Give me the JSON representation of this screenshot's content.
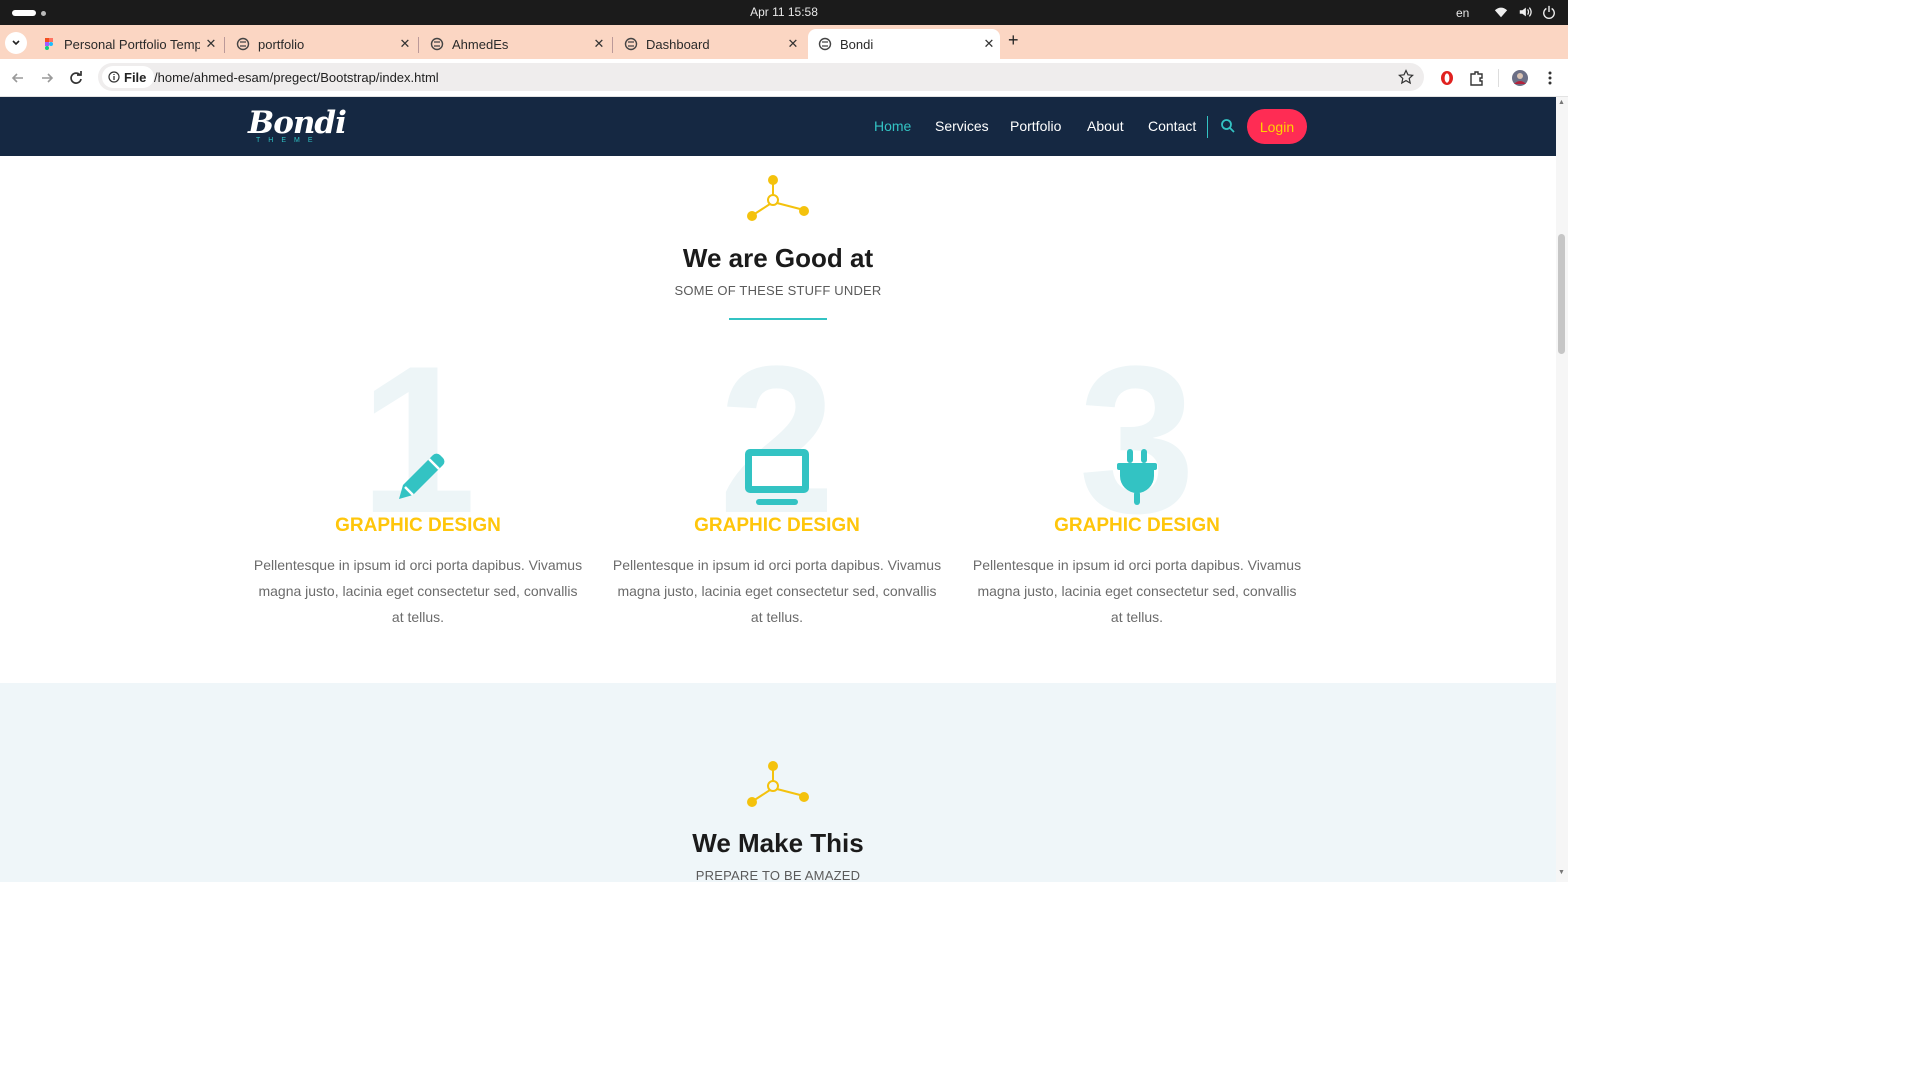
{
  "os": {
    "datetime": "Apr 11  15:58",
    "lang": "en"
  },
  "tabs": [
    {
      "title": "Personal Portfolio Templ",
      "active": false
    },
    {
      "title": "portfolio",
      "active": false
    },
    {
      "title": "AhmedEs",
      "active": false
    },
    {
      "title": "Dashboard",
      "active": false
    },
    {
      "title": "Bondi",
      "active": true
    }
  ],
  "toolbar": {
    "chip": "File",
    "url": "/home/ahmed-esam/pregect/Bootstrap/index.html"
  },
  "navbar": {
    "logo": "Bondi",
    "logo_sub": "THEME",
    "items": [
      "Home",
      "Services",
      "Portfolio",
      "About",
      "Contact"
    ],
    "active": "Home",
    "login": "Login"
  },
  "services": {
    "title": "We are Good at",
    "subtitle": "SOME OF THESE STUFF UNDER",
    "features": [
      {
        "num": "1",
        "icon": "pencil-icon",
        "title": "GRAPHIC DESIGN",
        "text": "Pellentesque in ipsum id orci porta dapibus. Vivamus magna justo, lacinia eget consectetur sed, convallis at tellus."
      },
      {
        "num": "2",
        "icon": "monitor-icon",
        "title": "GRAPHIC DESIGN",
        "text": "Pellentesque in ipsum id orci porta dapibus. Vivamus magna justo, lacinia eget consectetur sed, convallis at tellus."
      },
      {
        "num": "3",
        "icon": "plug-icon",
        "title": "GRAPHIC DESIGN",
        "text": "Pellentesque in ipsum id orci porta dapibus. Vivamus magna justo, lacinia eget consectetur sed, convallis at tellus."
      }
    ]
  },
  "portfolio": {
    "title": "We Make This",
    "subtitle": "PREPARE TO BE AMAZED"
  },
  "colors": {
    "accent": "#33c3c3",
    "yellow": "#ffc60b",
    "navy": "#152842",
    "login": "#ff2c54",
    "tabstrip": "#fbd6c3"
  }
}
